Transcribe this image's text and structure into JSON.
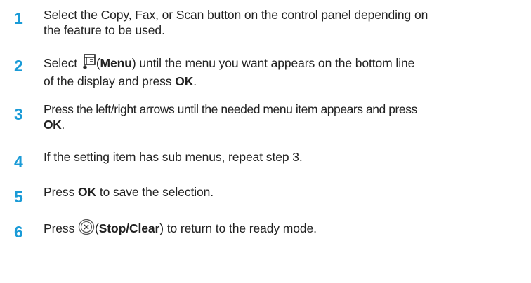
{
  "steps": [
    {
      "number": "1",
      "line1": "Select the Copy, Fax, or Scan button on the control panel depending on",
      "line2": "the feature to be used."
    },
    {
      "number": "2",
      "pre": "Select",
      "icon": "menu-icon",
      "open_paren": "(",
      "bold": "Menu",
      "after_bold": ") until the menu you want appears on the bottom line",
      "line2_pre": "of the display and press ",
      "line2_bold": "OK",
      "line2_post": "."
    },
    {
      "number": "3",
      "line1": "Press the left/right arrows until the needed menu item appears and press",
      "line2_bold": "OK",
      "line2_post": "."
    },
    {
      "number": "4",
      "line1": "If the setting item has sub menus, repeat step 3."
    },
    {
      "number": "5",
      "pre": "Press ",
      "bold": "OK",
      "post": " to save the selection."
    },
    {
      "number": "6",
      "pre": "Press",
      "icon": "stop-clear-icon",
      "open_paren": "(",
      "bold": "Stop/Clear",
      "post": ") to return to the ready mode."
    }
  ],
  "colors": {
    "step_number": "#1a9bd7",
    "text": "#222222"
  }
}
